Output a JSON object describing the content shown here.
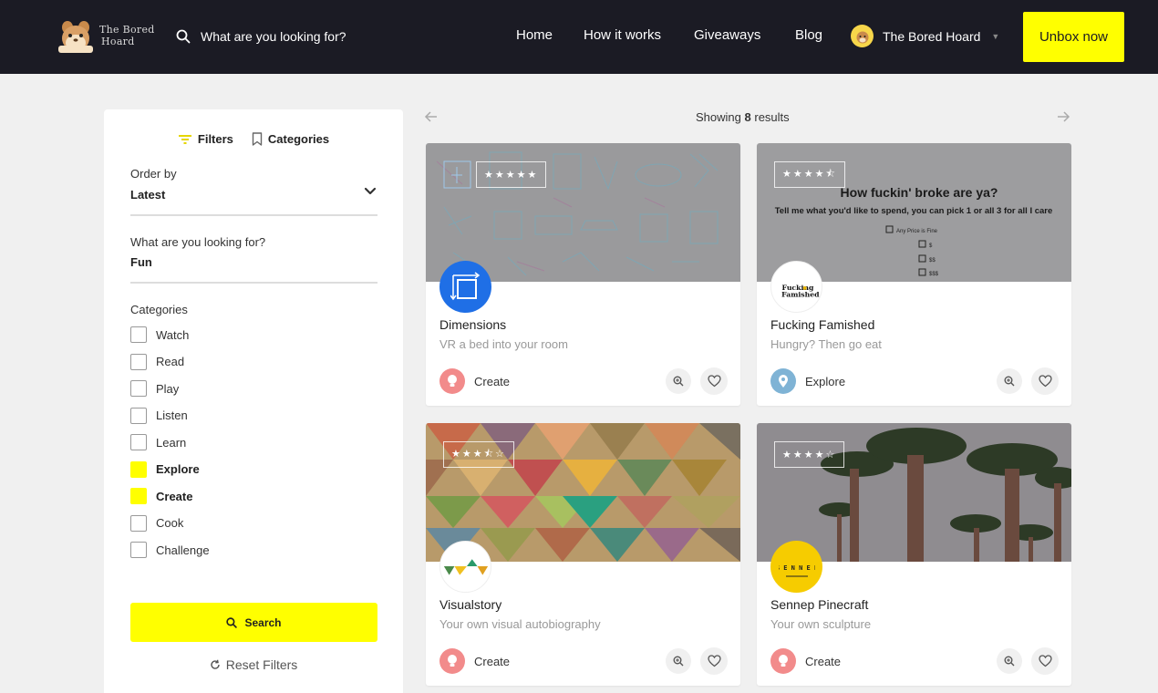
{
  "header": {
    "logo_line1": "The Bored",
    "logo_line2": "Hoard",
    "search_placeholder": "What are you looking for?",
    "nav": [
      "Home",
      "How it works",
      "Giveaways",
      "Blog"
    ],
    "user_name": "The Bored Hoard",
    "cta": "Unbox now"
  },
  "sidebar": {
    "tab_filters": "Filters",
    "tab_categories": "Categories",
    "order_label": "Order by",
    "order_value": "Latest",
    "query_label": "What are you looking for?",
    "query_value": "Fun",
    "categories_label": "Categories",
    "categories": [
      {
        "label": "Watch",
        "checked": false
      },
      {
        "label": "Read",
        "checked": false
      },
      {
        "label": "Play",
        "checked": false
      },
      {
        "label": "Listen",
        "checked": false
      },
      {
        "label": "Learn",
        "checked": false
      },
      {
        "label": "Explore",
        "checked": true
      },
      {
        "label": "Create",
        "checked": true
      },
      {
        "label": "Cook",
        "checked": false
      },
      {
        "label": "Challenge",
        "checked": false
      }
    ],
    "search_button": "Search",
    "reset_button": "Reset Filters"
  },
  "results": {
    "showing_prefix": "Showing",
    "count": "8",
    "showing_suffix": "results"
  },
  "image_text": {
    "ff_headline": "How fuckin' broke are ya?",
    "ff_line": "Tell me what you'd like to spend, you can pick 1 or all 3 for all I care",
    "ff_opt0": "Any Price is Fine",
    "ff_opt1": "$",
    "ff_opt2": "$$",
    "ff_opt3": "$$$",
    "ff_logo_1": "Fucking",
    "ff_logo_2": "Famished",
    "sennep_logo": "S E N N E P"
  },
  "cards": [
    {
      "title": "Dimensions",
      "subtitle": "VR a bed into your room",
      "category": "Create",
      "stars": "★★★★★",
      "rating": 5
    },
    {
      "title": "Fucking Famished",
      "subtitle": "Hungry? Then go eat",
      "category": "Explore",
      "stars": "★★★★⯪",
      "rating": 4.5
    },
    {
      "title": "Visualstory",
      "subtitle": "Your own visual autobiography",
      "category": "Create",
      "stars": "★★★⯪☆",
      "rating": 3.5
    },
    {
      "title": "Sennep Pinecraft",
      "subtitle": "Your own sculpture",
      "category": "Create",
      "stars": "★★★★☆",
      "rating": 4
    }
  ],
  "colors": {
    "accent": "#ffff00",
    "header_bg": "#1b1b24",
    "create_badge": "#f28b8b",
    "explore_badge": "#7fb3d5"
  }
}
